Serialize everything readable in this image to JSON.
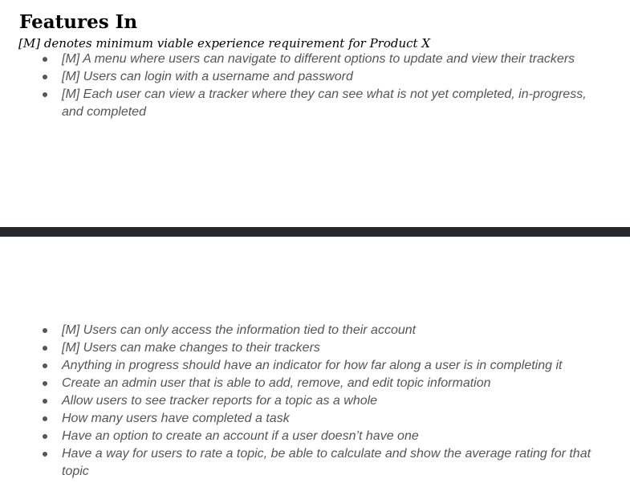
{
  "section": {
    "title": "Features In",
    "subtitle": "[M] denotes minimum viable experience requirement for Product X"
  },
  "features_page1": [
    "[M] A menu where users can navigate to different options to update and view their trackers",
    "[M] Users can login with a username and password",
    "[M] Each user can view a tracker where they can see what is not yet completed, in-progress, and completed"
  ],
  "features_page2": [
    "[M] Users can only access the information tied to their account",
    "[M] Users can make changes to their trackers",
    "Anything in progress should have an indicator for how far along a user is in completing it",
    "Create an admin user that is able to add, remove, and edit topic information",
    "Allow users to see tracker reports for a topic as a whole",
    "How many users have completed a task",
    "Have an option to create an account if a user doesn’t have one",
    "Have a way for users to rate a topic, be able to calculate and show the average rating for that topic"
  ],
  "colors": {
    "body_text": "#555555",
    "heading_text": "#000000",
    "page_separator": "#26272c"
  }
}
